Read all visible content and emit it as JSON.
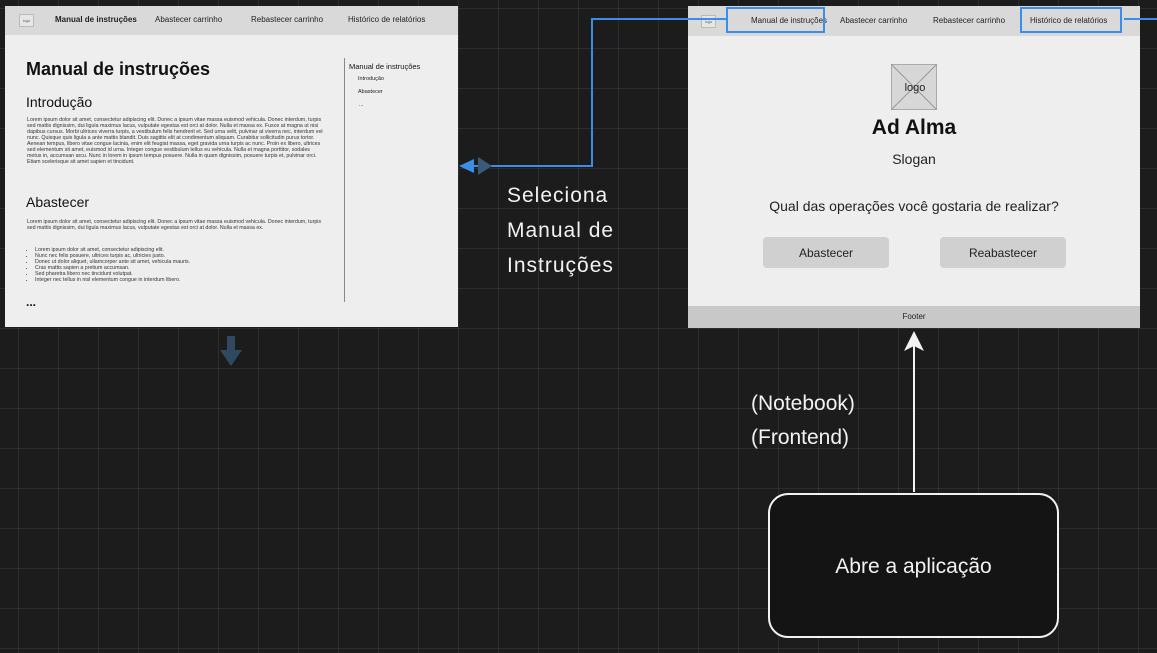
{
  "nav_items": [
    "Manual de instruções",
    "Abastecer carrinho",
    "Rebastecer carrinho",
    "Histórico de relatórios"
  ],
  "logo_mini_text": "logo",
  "manual": {
    "title": "Manual de instruções",
    "section1_title": "Introdução",
    "section1_text": "Lorem ipsum dolor sit amet, consectetur adipiscing elit. Donec a ipsum vitae massa euismod vehicula. Donec interdum, turpis sed mattis dignissim, dui ligula maximus lacus, vulputate egestas est orci at dolor. Nulla et massa ex. Fusce at magna ut nisi dapibus cursus. Morbi ultrices viverra turpis, a vestibulum felis hendrerit et. Sed urna velit, pulvinar at viverra nec, interdum vel nunc. Quisque quis ligula a ante mattis blandit. Duis sagittis elit at condimentum aliquam. Curabitur sollicitudin purus tortor. Aenean tempus, libero vitae congue lacinia, enim elit feugiat massa, eget gravida urna turpis ac nunc. Proin ex libero, ultrices sed elementum sit amet, euismod id urna. Integer congue vestibulum tellus eu vehicula. Nulla et magna porttitor, sodales metus in, accumsan arcu. Nunc in lorem in ipsum tempus posuere. Nulla in quam dignissim, posuere turpis et, pulvinar orci. Etiam scelerisque sit amet sapien et tincidunt.",
    "section2_title": "Abastecer",
    "section2_text": "Lorem ipsum dolor sit amet, consectetur adipiscing elit. Donec a ipsum vitae massa euismod vehicula. Donec interdum, turpis sed mattis dignissim, dui ligula maximus lacus, vulputate egestas est orci at dolor. Nulla et massa ex.",
    "bullets": [
      "Lorem ipsum dolor sit amet, consectetur adipiscing elit.",
      "Nunc nec felis posuere, ultrices turpis ac, ultricies justo.",
      "Donec ut dolor aliquet, ullamcorper ante sit amet, vehicula mauris.",
      "Cras mattis sapien a pretium accumsan.",
      "Sed pharetra libero nec tincidunt volutpat.",
      "Integer nec tellus in nisl elementum congue in interdum libero."
    ],
    "ellipsis": "...",
    "toc_title": "Manual de instruções",
    "toc_items": [
      "Introdução",
      "Abastecer",
      "..."
    ]
  },
  "home": {
    "logo_label": "logo",
    "app_name": "Ad Alma",
    "slogan": "Slogan",
    "question": "Qual das operações você gostaria de realizar?",
    "btn_abastecer": "Abastecer",
    "btn_reabastecer": "Reabastecer",
    "footer": "Footer"
  },
  "annotations": {
    "select_manual": [
      "Seleciona",
      "Manual de",
      "Instruções"
    ],
    "device": [
      "(Notebook)",
      "(Frontend)"
    ],
    "start": "Abre a aplicação"
  },
  "colors": {
    "canvas": "#1c1c1c",
    "highlight": "#3b8ee8",
    "frame": "#eeeeee",
    "nav": "#d9d9d9"
  }
}
